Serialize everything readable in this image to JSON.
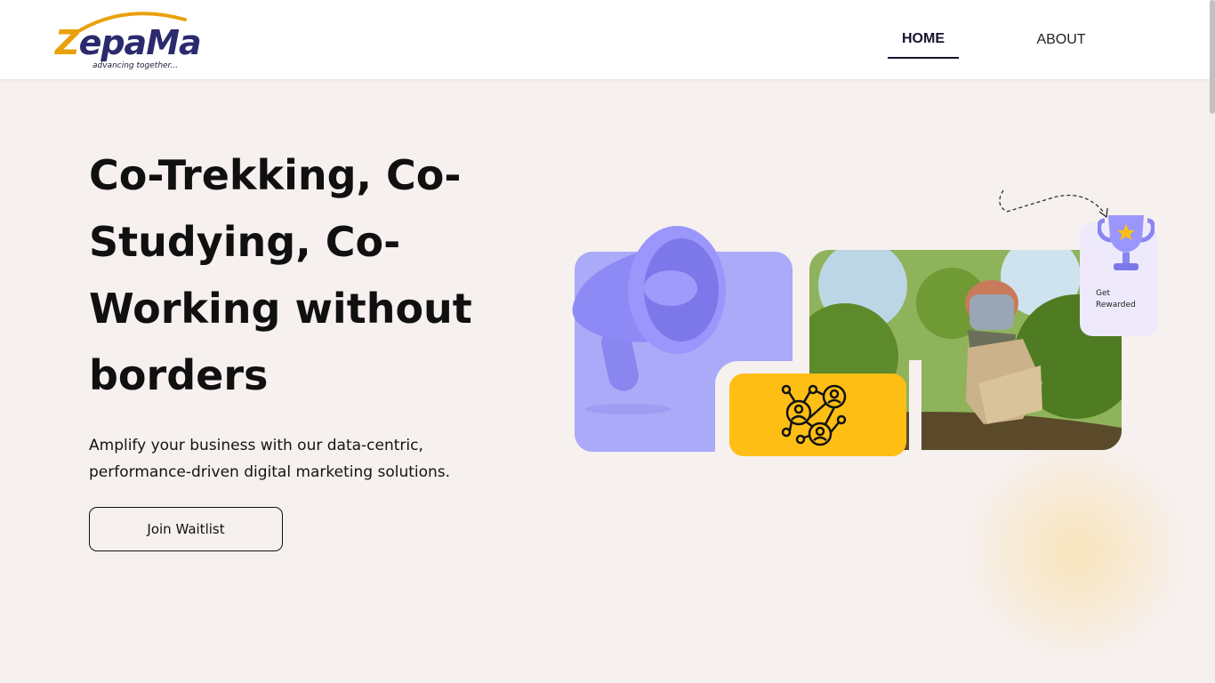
{
  "brand": {
    "name_part1": "Z",
    "name_part2": "epa",
    "name_part3": "Ma",
    "tagline": "advancing together..."
  },
  "nav": {
    "items": [
      {
        "label": "HOME",
        "active": true
      },
      {
        "label": "ABOUT",
        "active": false
      }
    ]
  },
  "hero": {
    "title": "Co-Trekking, Co-Studying, Co-Working without borders",
    "subtitle": "Amplify your business with our data-centric, performance-driven digital marketing solutions.",
    "cta_label": "Join Waitlist"
  },
  "collage": {
    "reward_label": "Get Rewarded",
    "icons": [
      "megaphone-icon",
      "network-icon",
      "trophy-icon"
    ]
  },
  "colors": {
    "background": "#f6f0ef",
    "purple": "#aaaaf9",
    "yellow": "#ffbe14",
    "brand_navy": "#2b2a6e",
    "brand_gold": "#e9a10b"
  }
}
